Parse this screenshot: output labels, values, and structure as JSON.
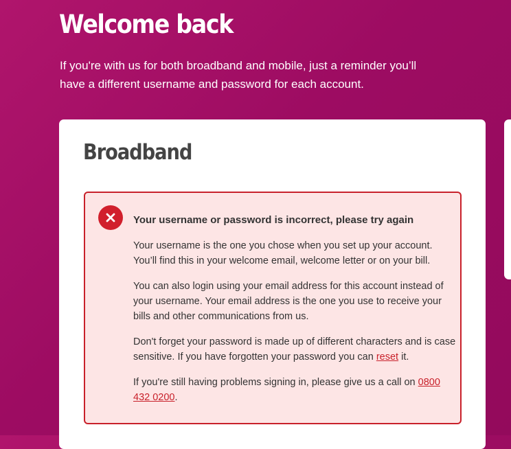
{
  "header": {
    "title": "Welcome back",
    "intro": "If you're with us for both broadband and mobile, just a reminder you’ll have a different username and password for each account."
  },
  "card": {
    "title": "Broadband",
    "error": {
      "icon": "error-x-icon",
      "heading": "Your username or password is incorrect, please try again",
      "para1": "Your username is the one you chose when you set up your account. You’ll find this in your welcome email, welcome letter or on your bill.",
      "para2": "You can also login using your email address for this account instead of your username. Your email address is the one you use to receive your bills and other communications from us.",
      "para3_before": "Don't forget your password is made up of different characters and is case sensitive. If you have forgotten your password you can ",
      "para3_link": "reset",
      "para3_after": " it.",
      "para4_before": "If you're still having problems signing in, please give us a call on ",
      "para4_link": "0800 432 0200",
      "para4_after": "."
    }
  },
  "colors": {
    "background": "#a0106a",
    "error_border": "#c8202a",
    "error_fill": "#fde5e5",
    "link": "#c8202a"
  }
}
